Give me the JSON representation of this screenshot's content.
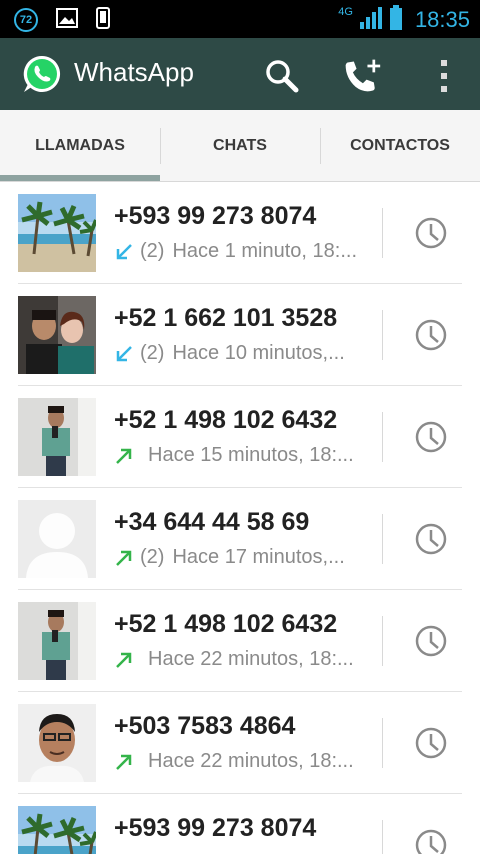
{
  "status_bar": {
    "badge": "72",
    "network": "4G",
    "time": "18:35",
    "icons": [
      "notification-badge-icon",
      "image-icon",
      "phone-device-icon",
      "signal-icon",
      "battery-icon"
    ]
  },
  "app_bar": {
    "title": "WhatsApp",
    "colors": {
      "bar": "#2e4a46",
      "logo_green": "#25d366"
    },
    "actions": [
      "search-icon",
      "new-call-icon",
      "overflow-menu-icon"
    ]
  },
  "tabs": [
    {
      "label": "LLAMADAS",
      "selected": true
    },
    {
      "label": "CHATS",
      "selected": false
    },
    {
      "label": "CONTACTOS",
      "selected": false
    }
  ],
  "calls": [
    {
      "number": "+593 99 273 8074",
      "direction": "incoming",
      "count": "(2)",
      "detail": "Hace 1 minuto, 18:...",
      "avatar": "beach"
    },
    {
      "number": "+52 1 662 101 3528",
      "direction": "incoming",
      "count": "(2)",
      "detail": "Hace 10 minutos,...",
      "avatar": "couple"
    },
    {
      "number": "+52 1 498 102 6432",
      "direction": "outgoing",
      "count": "",
      "detail": "Hace 15 minutos, 18:...",
      "avatar": "mirror"
    },
    {
      "number": "+34 644 44 58 69",
      "direction": "outgoing",
      "count": "(2)",
      "detail": "Hace 17 minutos,...",
      "avatar": "default"
    },
    {
      "number": "+52 1 498 102 6432",
      "direction": "outgoing",
      "count": "",
      "detail": "Hace 22 minutos, 18:...",
      "avatar": "mirror"
    },
    {
      "number": "+503 7583 4864",
      "direction": "outgoing",
      "count": "",
      "detail": "Hace 22 minutos, 18:...",
      "avatar": "man"
    },
    {
      "number": "+593 99 273 8074",
      "direction": "incoming",
      "count": "",
      "detail": "",
      "avatar": "beach"
    }
  ],
  "colors": {
    "incoming": "#33b5e5",
    "outgoing": "#34b44a",
    "clock": "#8a8a8a"
  }
}
